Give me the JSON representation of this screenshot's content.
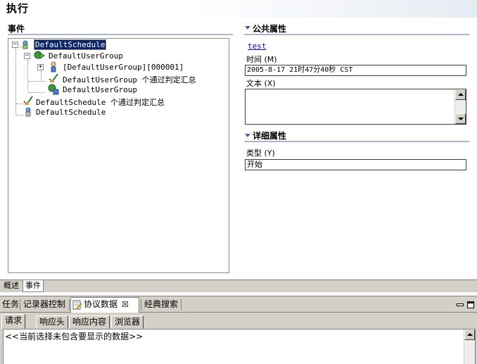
{
  "header": {
    "title": "执行"
  },
  "events": {
    "section_title": "事件",
    "tree": [
      {
        "label": "DefaultSchedule",
        "selected": true
      },
      {
        "label": "DefaultUserGroup"
      },
      {
        "label": "[DefaultUserGroup][000001]"
      },
      {
        "label": "DefaultUserGroup 个通过判定汇总"
      },
      {
        "label": "DefaultUserGroup"
      },
      {
        "label": "DefaultSchedule 个通过判定汇总"
      },
      {
        "label": "DefaultSchedule"
      }
    ]
  },
  "common_props": {
    "section_title": "公共属性",
    "link": "test",
    "time_label": "时间 (M)",
    "time_value": "2005-8-17 21时47分40秒 CST",
    "text_label": "文本 (X)",
    "text_value": ""
  },
  "detail_props": {
    "section_title": "详细属性",
    "type_label": "类型 (Y)",
    "type_value": "开始"
  },
  "editor_tabs": [
    "概述",
    "事件"
  ],
  "view_tabs": [
    "任务",
    "记录器控制",
    "协议数据",
    "经典搜索"
  ],
  "sub_tabs": [
    "请求",
    "响应头",
    "响应内容",
    "浏览器"
  ],
  "content_message": "<<当前选择未包含要显示的数据>>",
  "colors": {
    "selection": "#0a246a",
    "link": "#0000cc",
    "section_rule": "#aab7cf",
    "chrome": "#d4d0c8"
  }
}
